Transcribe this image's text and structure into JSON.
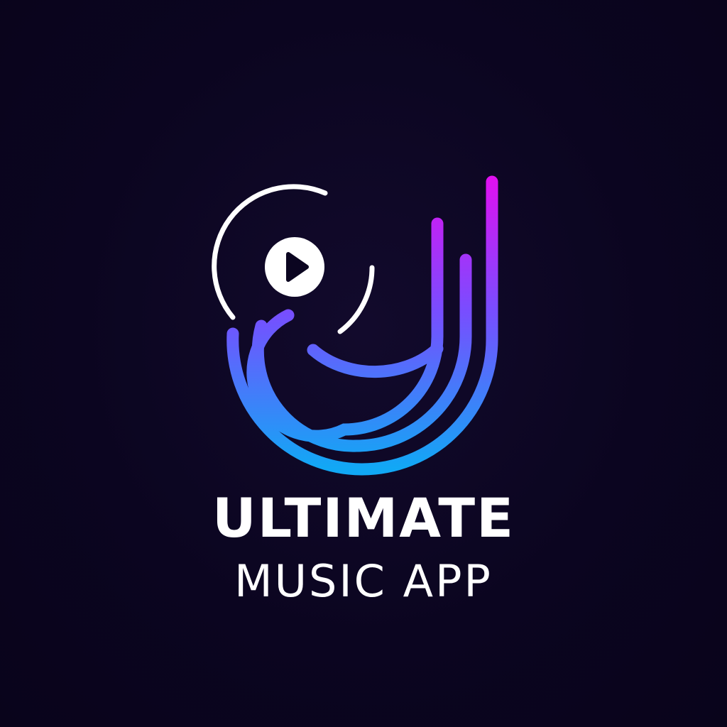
{
  "logo": {
    "wordmark_line1": "ULTIMATE",
    "wordmark_line2": "MUSIC APP",
    "icon_names": [
      "music-note-j-icon",
      "vinyl-disc-icon",
      "play-icon"
    ]
  },
  "colors": {
    "background": "#0b0520",
    "gradient_top": "#e010f0",
    "gradient_mid": "#7a4cff",
    "gradient_bottom": "#11a8f5",
    "disc_stroke": "#ffffff",
    "play_button_fill": "#ffffff",
    "play_triangle": "#0b0520",
    "text": "#ffffff"
  }
}
